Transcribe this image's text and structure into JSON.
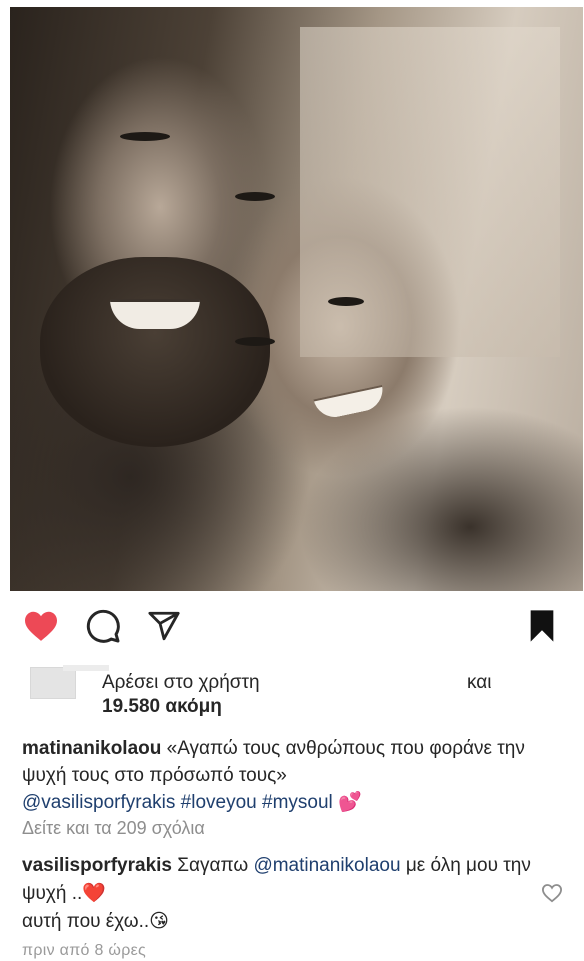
{
  "post": {
    "liked": true,
    "saved": true
  },
  "likes": {
    "prefix": "Αρέσει στο χρήστη",
    "and": "και",
    "count": "19.580 ακόμη"
  },
  "caption": {
    "username": "matinanikolaou",
    "text": "«Αγαπώ τους ανθρώπους που φοράνε την ψυχή τους στο πρόσωπό τους»",
    "mention": "@vasilisporfyrakis",
    "hashtag1": "#loveyou",
    "hashtag2": "#mysoul",
    "emoji": "💕"
  },
  "view_comments": "Δείτε και τα 209 σχόλια",
  "comment": {
    "username": "vasilisporfyrakis",
    "text1": "Σαγαπω",
    "mention": "@matinanikolaou",
    "text2": "με όλη μου την ψυχή ..",
    "emoji1": "❤️",
    "text3": "αυτή που έχω..",
    "emoji2": "😘"
  },
  "timestamp": "πριν από 8 ώρες",
  "colors": {
    "like_red": "#ed4956",
    "text": "#262626",
    "link": "#1f3f6e",
    "muted": "#8e8e8e"
  },
  "icons": {
    "like": "heart-filled-icon",
    "comment": "comment-bubble-icon",
    "share": "paper-plane-icon",
    "save": "bookmark-filled-icon",
    "comment_like": "heart-outline-icon"
  }
}
